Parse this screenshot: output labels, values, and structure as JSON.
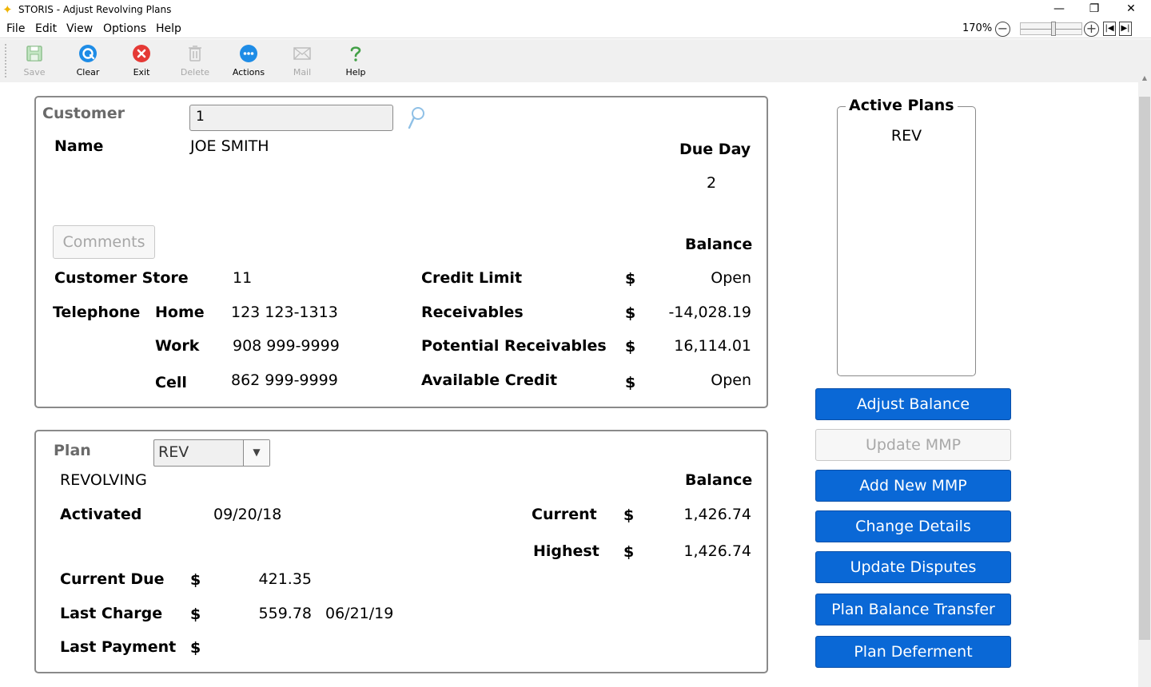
{
  "window": {
    "title": "STORIS - Adjust Revolving Plans",
    "controls": {
      "minimize": "—",
      "restore": "❐",
      "close": "✕"
    }
  },
  "menu": {
    "items": [
      "File",
      "Edit",
      "View",
      "Options",
      "Help"
    ],
    "zoom_level": "170%"
  },
  "toolbar": {
    "buttons": [
      {
        "label": "Save",
        "icon": "save-icon",
        "enabled": false
      },
      {
        "label": "Clear",
        "icon": "clear-icon",
        "enabled": true
      },
      {
        "label": "Exit",
        "icon": "exit-icon",
        "enabled": true
      },
      {
        "label": "Delete",
        "icon": "delete-icon",
        "enabled": false
      },
      {
        "label": "Actions",
        "icon": "actions-icon",
        "enabled": true
      },
      {
        "label": "Mail",
        "icon": "mail-icon",
        "enabled": false
      },
      {
        "label": "Help",
        "icon": "help-icon",
        "enabled": true
      }
    ]
  },
  "customer": {
    "label": "Customer",
    "number": "1",
    "name_label": "Name",
    "name": "JOE SMITH",
    "due_day_label": "Due Day",
    "due_day": "2",
    "comments_label": "Comments",
    "balance_label": "Balance",
    "store_label": "Customer Store",
    "store": "11",
    "telephone_label": "Telephone",
    "home_label": "Home",
    "home": "123 123-1313",
    "work_label": "Work",
    "work": "908 999-9999",
    "cell_label": "Cell",
    "cell": "862 999-9999",
    "credit_limit_label": "Credit Limit",
    "credit_limit": "Open",
    "receivables_label": "Receivables",
    "receivables": "-14,028.19",
    "potential_label": "Potential Receivables",
    "potential": "16,114.01",
    "available_label": "Available Credit",
    "available": "Open",
    "currency": "$"
  },
  "plan": {
    "label": "Plan",
    "selected": "REV",
    "description": "REVOLVING",
    "balance_label": "Balance",
    "activated_label": "Activated",
    "activated": "09/20/18",
    "current_label": "Current",
    "current": "1,426.74",
    "highest_label": "Highest",
    "highest": "1,426.74",
    "current_due_label": "Current Due",
    "current_due": "421.35",
    "last_charge_label": "Last Charge",
    "last_charge": "559.78",
    "last_charge_date": "06/21/19",
    "last_payment_label": "Last Payment",
    "currency": "$"
  },
  "active_plans": {
    "title": "Active Plans",
    "items": [
      "REV"
    ]
  },
  "actions": {
    "adjust_balance": "Adjust Balance",
    "update_mmp": "Update MMP",
    "add_new_mmp": "Add New MMP",
    "change_details": "Change Details",
    "update_disputes": "Update Disputes",
    "plan_balance_transfer": "Plan Balance Transfer",
    "plan_deferment": "Plan Deferment"
  },
  "colors": {
    "accent": "#0a68d6",
    "panel_border": "#8a8a8a",
    "toolbar_bg": "#f0f0f0"
  }
}
